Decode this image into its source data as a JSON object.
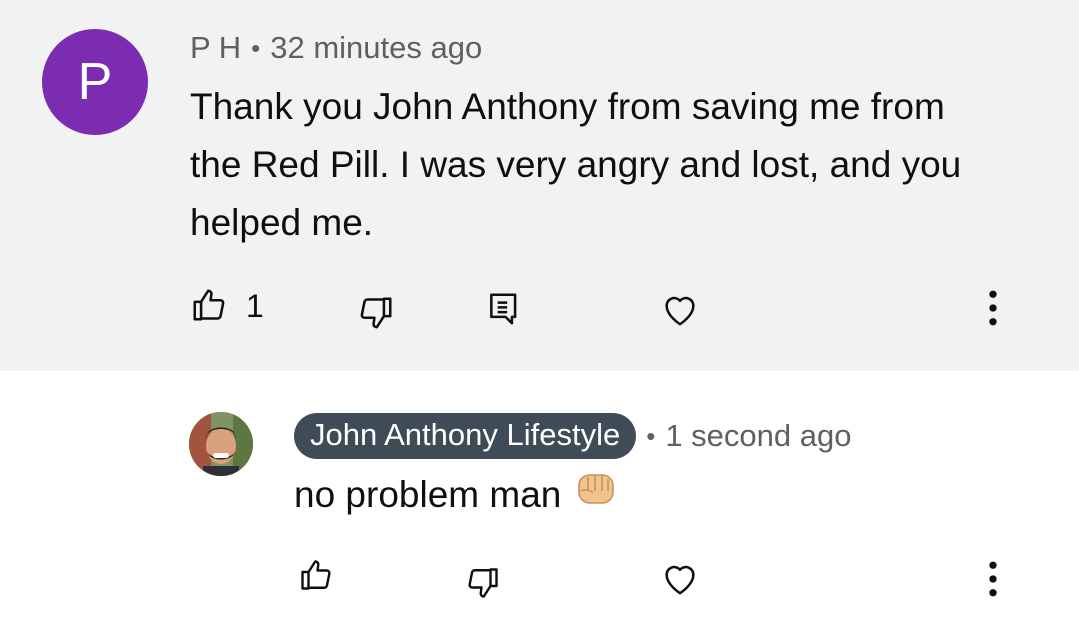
{
  "top_comment": {
    "avatar_letter": "P",
    "author": "P H",
    "separator": "•",
    "time": "32 minutes ago",
    "text": "Thank you John Anthony from saving me from the Red Pill. I was very angry and lost, and you helped me.",
    "like_count": "1",
    "avatar_color": "#7b2cb0",
    "background": "#f2f2f2"
  },
  "reply": {
    "author": "John Anthony Lifestyle",
    "separator": "•",
    "time": "1 second ago",
    "text": "no problem man",
    "emoji": "fist-bump",
    "author_chip_color": "#3f4b57"
  },
  "icons": {
    "like": "thumbs-up-icon",
    "dislike": "thumbs-down-icon",
    "reply": "comment-icon",
    "heart": "heart-icon",
    "more": "more-vert-icon"
  }
}
